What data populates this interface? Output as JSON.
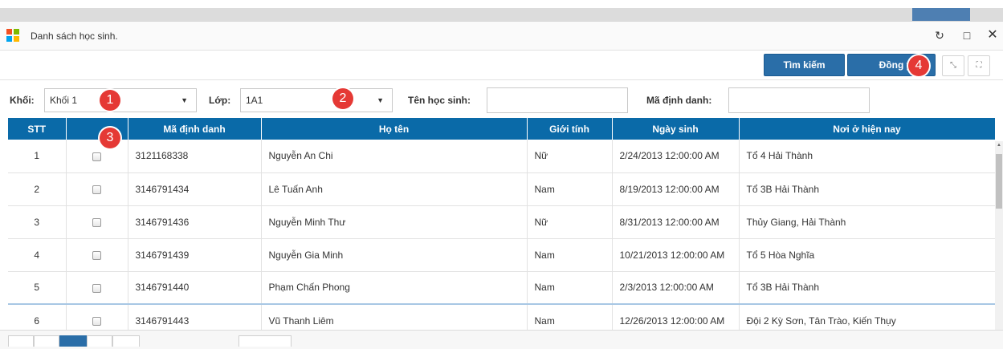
{
  "dialog": {
    "title": "Danh sách học sinh."
  },
  "toolbar": {
    "search_label": "Tìm kiếm",
    "ok_label": "Đồng ý"
  },
  "filters": {
    "grade_label": "Khối:",
    "grade_value": "Khối 1",
    "class_label": "Lớp:",
    "class_value": "1A1",
    "student_name_label": "Tên học sinh:",
    "student_name_value": "",
    "id_label": "Mã định danh:",
    "id_value": ""
  },
  "badges": [
    "1",
    "2",
    "3",
    "4"
  ],
  "table": {
    "columns": [
      "STT",
      "",
      "Mã định danh",
      "Họ tên",
      "Giới tính",
      "Ngày sinh",
      "Nơi ở hiện nay"
    ],
    "rows": [
      {
        "stt": "1",
        "checked": false,
        "id": "3121168338",
        "name": "Nguyễn An Chi",
        "gender": "Nữ",
        "dob": "2/24/2013 12:00:00 AM",
        "address": "Tổ 4 Hải Thành"
      },
      {
        "stt": "2",
        "checked": false,
        "id": "3146791434",
        "name": "Lê Tuấn Anh",
        "gender": "Nam",
        "dob": "8/19/2013 12:00:00 AM",
        "address": "Tổ 3B Hải Thành"
      },
      {
        "stt": "3",
        "checked": false,
        "id": "3146791436",
        "name": "Nguyễn Minh Thư",
        "gender": "Nữ",
        "dob": "8/31/2013 12:00:00 AM",
        "address": "Thủy Giang, Hải Thành"
      },
      {
        "stt": "4",
        "checked": false,
        "id": "3146791439",
        "name": "Nguyễn Gia Minh",
        "gender": "Nam",
        "dob": "10/21/2013 12:00:00 AM",
        "address": "Tổ 5 Hòa Nghĩa"
      },
      {
        "stt": "5",
        "checked": false,
        "id": "3146791440",
        "name": "Phạm Chấn Phong",
        "gender": "Nam",
        "dob": "2/3/2013 12:00:00 AM",
        "address": "Tổ 3B Hải Thành"
      },
      {
        "stt": "6",
        "checked": false,
        "id": "3146791443",
        "name": "Vũ Thanh Liêm",
        "gender": "Nam",
        "dob": "12/26/2013 12:00:00 AM",
        "address": "Đội 2 Kỳ Sơn, Tân Trào, Kiến Thụy"
      }
    ]
  },
  "colors": {
    "header_bg": "#0a6aa8",
    "button_bg": "#2a6ea8",
    "badge": "#e53935"
  },
  "icons": [
    "windows-logo-icon",
    "refresh-icon",
    "maximize-icon",
    "close-icon",
    "collapse-icon",
    "fullscreen-icon",
    "chevron-down-icon"
  ]
}
